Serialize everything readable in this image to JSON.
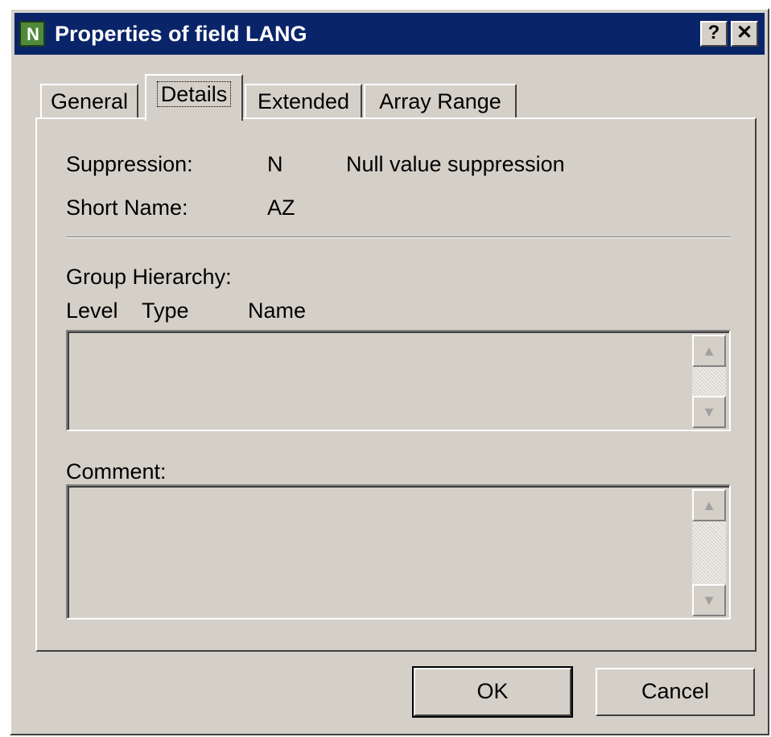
{
  "window": {
    "title": "Properties of field LANG",
    "app_icon_letter": "N",
    "help_label": "?",
    "close_label": "✕"
  },
  "tabs": [
    {
      "label": "General",
      "active": false
    },
    {
      "label": "Details",
      "active": true
    },
    {
      "label": "Extended",
      "active": false
    },
    {
      "label": "Array Range",
      "active": false
    }
  ],
  "details": {
    "suppression_label": "Suppression:",
    "suppression_value": "N",
    "suppression_description": "Null value suppression",
    "short_name_label": "Short Name:",
    "short_name_value": "AZ",
    "group_hierarchy_label": "Group Hierarchy:",
    "columns": [
      "Level",
      "Type",
      "Name"
    ],
    "comment_label": "Comment:"
  },
  "buttons": {
    "ok": "OK",
    "cancel": "Cancel"
  },
  "icons": {
    "scroll_up": "▲",
    "scroll_down": "▼"
  }
}
